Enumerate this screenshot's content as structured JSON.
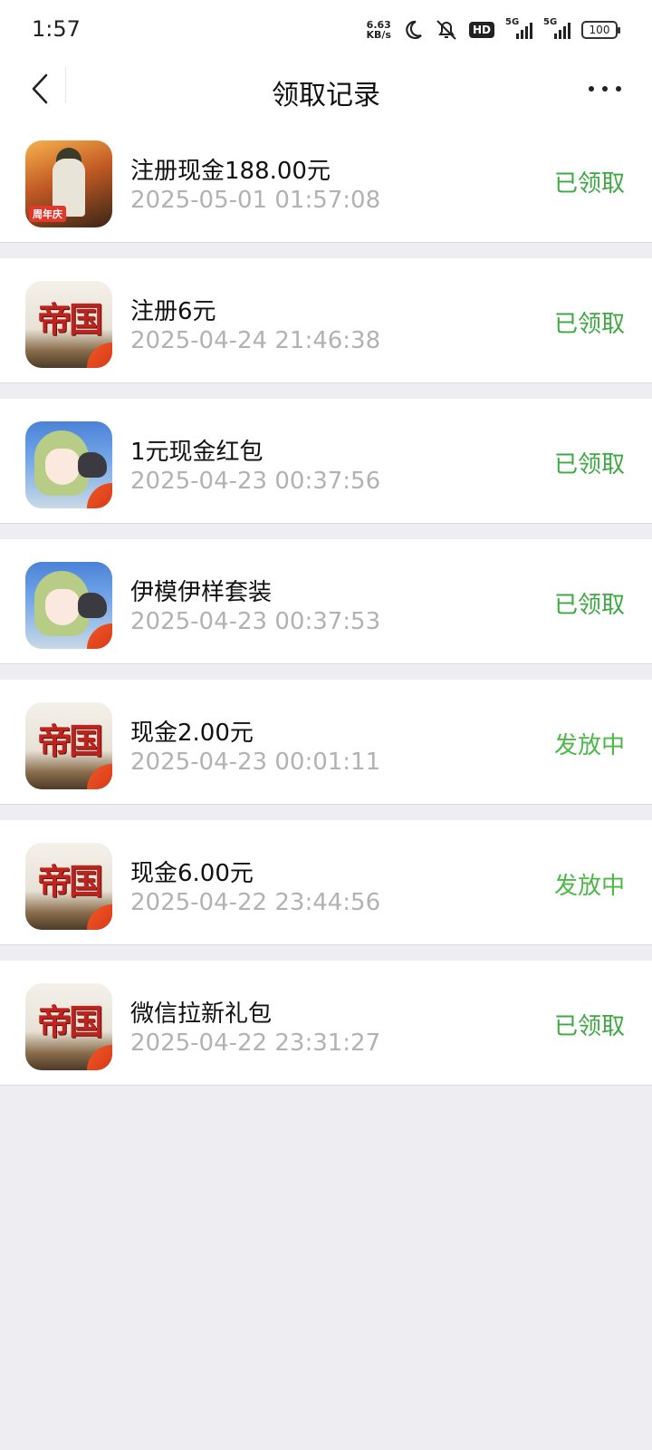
{
  "status_bar": {
    "time": "1:57",
    "net_speed_value": "6.63",
    "net_speed_unit": "KB/s",
    "hd_label": "HD",
    "signal1_label": "5G",
    "signal2_label": "5G",
    "battery_level": "100"
  },
  "nav": {
    "title": "领取记录"
  },
  "records": [
    {
      "title": "注册现金188.00元",
      "time": "2025-05-01 01:57:08",
      "status": "已领取",
      "icon_badge": "周年庆"
    },
    {
      "title": "注册6元",
      "time": "2025-04-24 21:46:38",
      "status": "已领取",
      "icon_word": "帝国"
    },
    {
      "title": "1元现金红包",
      "time": "2025-04-23 00:37:56",
      "status": "已领取"
    },
    {
      "title": "伊模伊样套装",
      "time": "2025-04-23 00:37:53",
      "status": "已领取"
    },
    {
      "title": "现金2.00元",
      "time": "2025-04-23 00:01:11",
      "status": "发放中",
      "icon_word": "帝国"
    },
    {
      "title": "现金6.00元",
      "time": "2025-04-22 23:44:56",
      "status": "发放中",
      "icon_word": "帝国"
    },
    {
      "title": "微信拉新礼包",
      "time": "2025-04-22 23:31:27",
      "status": "已领取",
      "icon_word": "帝国"
    }
  ],
  "colors": {
    "received": "#3EA843",
    "pending": "#4DB848",
    "timestamp": "#B2B2B2",
    "background": "#EDEDF2"
  }
}
